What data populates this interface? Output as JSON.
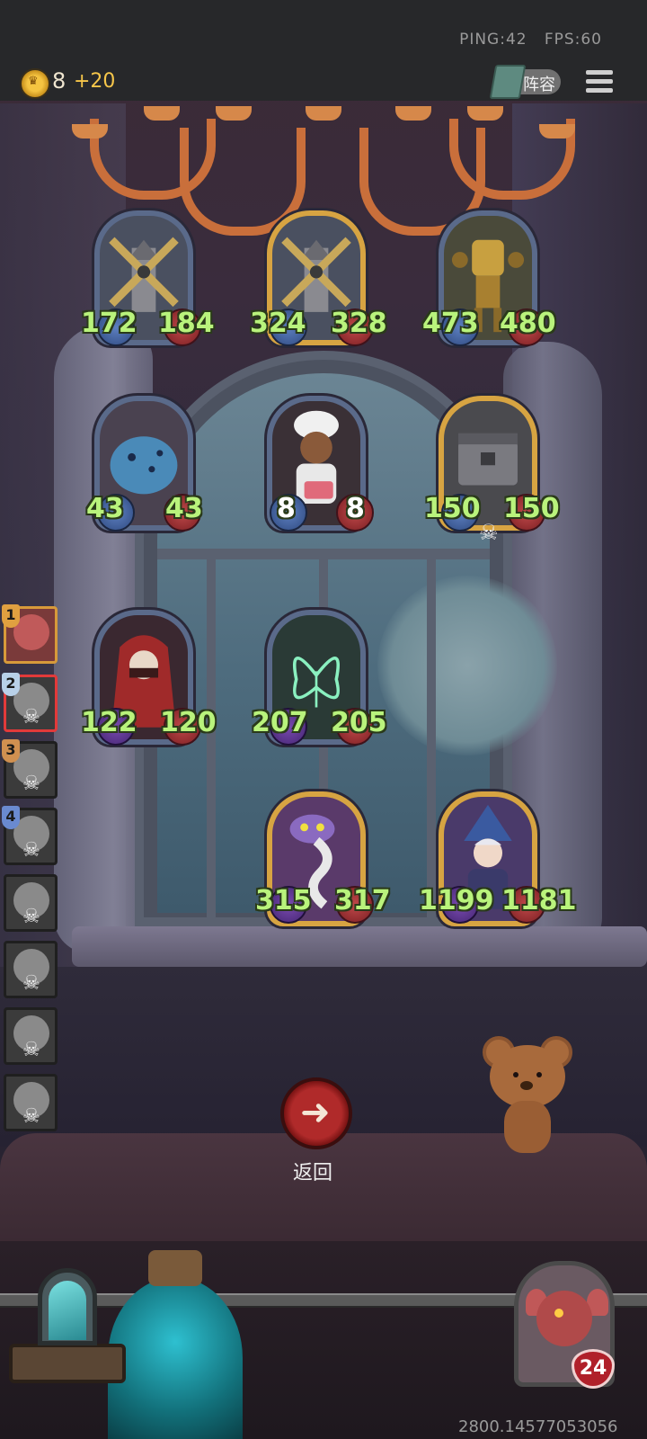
{
  "topbar": {
    "ping": "PING:42",
    "fps": "FPS:60",
    "gold": "8",
    "gold_income": "+20",
    "lineup_label": "阵容"
  },
  "board": {
    "cards": [
      {
        "id": "windmill-1",
        "attack": "172",
        "health": "184",
        "frame": "blue"
      },
      {
        "id": "windmill-2",
        "attack": "324",
        "health": "328",
        "frame": "gold"
      },
      {
        "id": "golem",
        "attack": "473",
        "health": "480",
        "frame": "blue"
      },
      {
        "id": "lizard",
        "attack": "43",
        "health": "43",
        "frame": "blue"
      },
      {
        "id": "chef",
        "attack": "8",
        "health": "8",
        "frame": "blue"
      },
      {
        "id": "chest-trap",
        "attack": "150",
        "health": "150",
        "frame": "gold"
      },
      {
        "id": "hooded-assassin",
        "attack": "122",
        "health": "120",
        "frame": "blue"
      },
      {
        "id": "butterfly-spirit",
        "attack": "207",
        "health": "205",
        "frame": "blue"
      },
      {
        "id": "clockwork-serpent",
        "attack": "315",
        "health": "317",
        "frame": "gold"
      },
      {
        "id": "wizard",
        "attack": "1199",
        "health": "1181",
        "frame": "gold"
      }
    ]
  },
  "roster": {
    "badges": [
      "1",
      "2",
      "3",
      "4"
    ]
  },
  "back": {
    "label": "返回"
  },
  "hero": {
    "health": "24"
  },
  "seed": "2800.14577053056",
  "colors": {
    "stat_text": "#b9f37c",
    "gold_frame": "#d7a442",
    "blue_frame": "#5a6a8a",
    "back_button": "#b02a2a"
  }
}
